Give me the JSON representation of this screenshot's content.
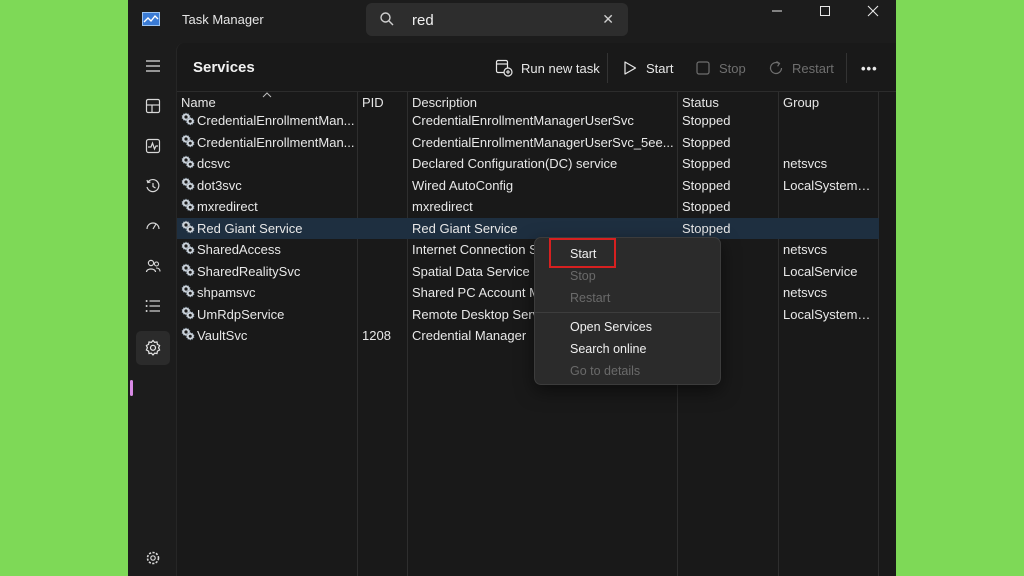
{
  "window": {
    "title": "Task Manager",
    "search": {
      "value": "red",
      "placeholder": ""
    }
  },
  "sidebar": {
    "items": [
      {
        "icon": "hamburger-icon"
      },
      {
        "icon": "processes-icon"
      },
      {
        "icon": "performance-icon"
      },
      {
        "icon": "app-history-icon"
      },
      {
        "icon": "startup-apps-icon"
      },
      {
        "icon": "users-icon"
      },
      {
        "icon": "details-icon"
      },
      {
        "icon": "services-icon",
        "active": true
      },
      {
        "icon": "settings-icon"
      }
    ],
    "accent": "#d98be6"
  },
  "toolbar": {
    "title": "Services",
    "run_new_task": "Run new task",
    "start": "Start",
    "stop": "Stop",
    "restart": "Restart",
    "more": "•••"
  },
  "table": {
    "columns": [
      "Name",
      "PID",
      "Description",
      "Status",
      "Group"
    ],
    "rows": [
      {
        "name": "CredentialEnrollmentMan...",
        "pid": "",
        "description": "CredentialEnrollmentManagerUserSvc",
        "status": "Stopped",
        "group": ""
      },
      {
        "name": "CredentialEnrollmentMan...",
        "pid": "",
        "description": "CredentialEnrollmentManagerUserSvc_5ee...",
        "status": "Stopped",
        "group": ""
      },
      {
        "name": "dcsvc",
        "pid": "",
        "description": "Declared Configuration(DC) service",
        "status": "Stopped",
        "group": "netsvcs"
      },
      {
        "name": "dot3svc",
        "pid": "",
        "description": "Wired AutoConfig",
        "status": "Stopped",
        "group": "LocalSystemN..."
      },
      {
        "name": "mxredirect",
        "pid": "",
        "description": "mxredirect",
        "status": "Stopped",
        "group": ""
      },
      {
        "name": "Red Giant Service",
        "pid": "",
        "description": "Red Giant Service",
        "status": "Stopped",
        "group": "",
        "selected": true
      },
      {
        "name": "SharedAccess",
        "pid": "",
        "description": "Internet Connection S",
        "status": "ed",
        "group": "netsvcs"
      },
      {
        "name": "SharedRealitySvc",
        "pid": "",
        "description": "Spatial Data Service",
        "status": "ed",
        "group": "LocalService"
      },
      {
        "name": "shpamsvc",
        "pid": "",
        "description": "Shared PC Account M",
        "status": "ed",
        "group": "netsvcs"
      },
      {
        "name": "UmRdpService",
        "pid": "",
        "description": "Remote Desktop Serv",
        "status": "ed",
        "group": "LocalSystemN..."
      },
      {
        "name": "VaultSvc",
        "pid": "1208",
        "description": "Credential Manager",
        "status": "ng",
        "group": ""
      }
    ]
  },
  "context_menu": {
    "items": [
      "Start",
      "Stop",
      "Restart",
      "Open Services",
      "Search online",
      "Go to details"
    ],
    "highlight_color": "#d62020"
  }
}
